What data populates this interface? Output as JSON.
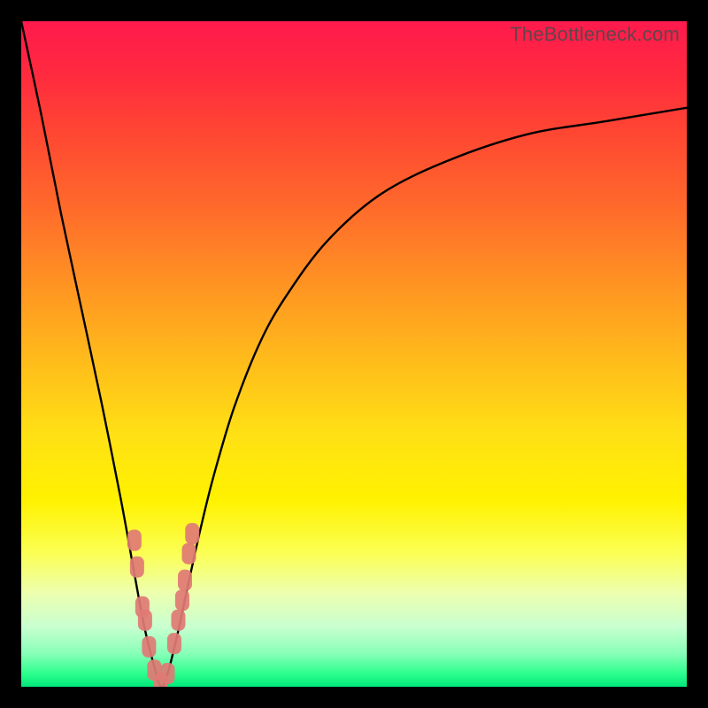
{
  "watermark": "TheBottleneck.com",
  "chart_data": {
    "type": "line",
    "title": "",
    "xlabel": "",
    "ylabel": "",
    "xlim": [
      0,
      100
    ],
    "ylim": [
      0,
      100
    ],
    "curve": {
      "description": "Bottleneck percentage curve; V-shaped with minimum near x≈21, then rising asymptotically toward ~87% at right edge.",
      "x": [
        0,
        3,
        6,
        9,
        12,
        15,
        17,
        18.5,
        20,
        21,
        22,
        23.5,
        25,
        27,
        29,
        32,
        36,
        40,
        46,
        54,
        64,
        76,
        88,
        100
      ],
      "y": [
        100,
        86,
        71,
        57,
        43,
        28,
        17,
        9,
        3,
        0,
        2,
        8,
        15,
        24,
        32,
        42,
        52,
        59,
        67,
        74,
        79,
        83,
        85,
        87
      ]
    },
    "markers": {
      "description": "Salmon rounded-rect markers clustered near the minimum, on both arms of the V.",
      "points": [
        {
          "x": 17.0,
          "y": 22
        },
        {
          "x": 17.4,
          "y": 18
        },
        {
          "x": 18.2,
          "y": 12
        },
        {
          "x": 18.6,
          "y": 10
        },
        {
          "x": 19.2,
          "y": 6
        },
        {
          "x": 20.0,
          "y": 2.5
        },
        {
          "x": 21.0,
          "y": 0.5
        },
        {
          "x": 22.0,
          "y": 2
        },
        {
          "x": 23.0,
          "y": 6.5
        },
        {
          "x": 23.6,
          "y": 10
        },
        {
          "x": 24.2,
          "y": 13
        },
        {
          "x": 24.6,
          "y": 16
        },
        {
          "x": 25.2,
          "y": 20
        },
        {
          "x": 25.7,
          "y": 23
        }
      ],
      "color": "#e07a74"
    }
  }
}
